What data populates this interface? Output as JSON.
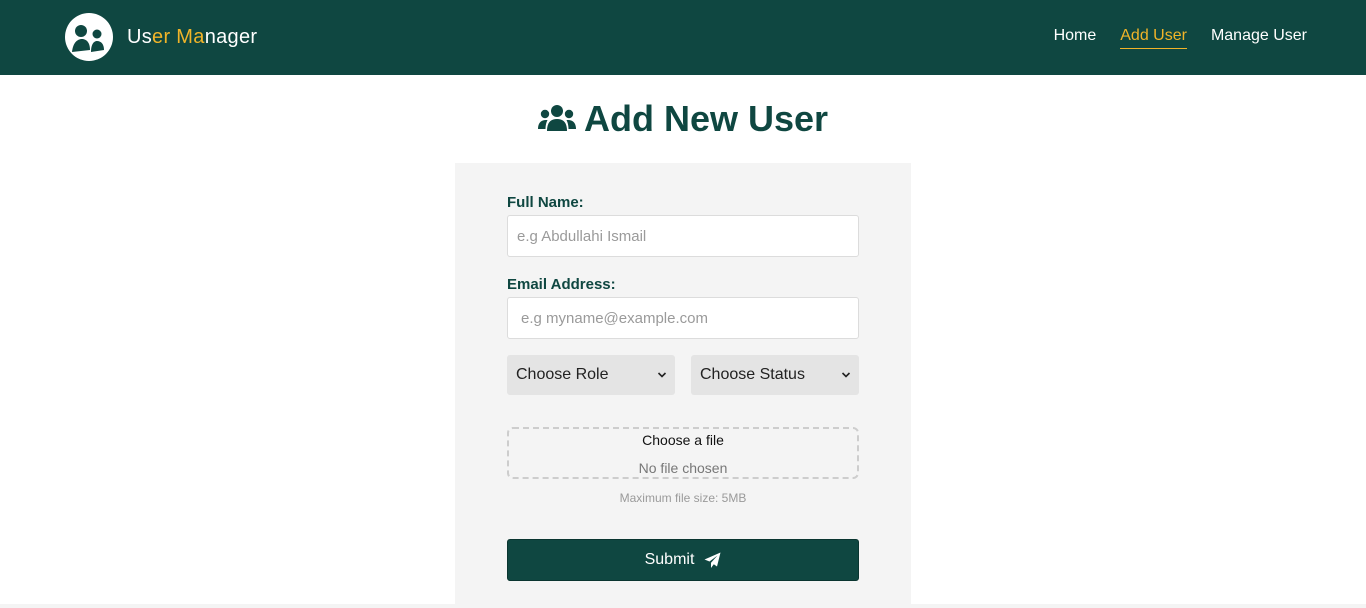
{
  "brand": {
    "name_part1": "Us",
    "name_part2": "er",
    "name_part3": " ",
    "name_part4": "Ma",
    "name_part5": "nager",
    "accent_color": "#f0b429",
    "bar_color": "#0f4741",
    "logo_icon": "user-group-logo-icon"
  },
  "nav": {
    "items": [
      {
        "label": "Home",
        "active": false
      },
      {
        "label": "Add User",
        "active": true
      },
      {
        "label": "Manage User",
        "active": false
      }
    ]
  },
  "page": {
    "title": "Add New User",
    "title_icon": "users-icon"
  },
  "form": {
    "full_name": {
      "label": "Full Name:",
      "value": "",
      "placeholder": "e.g Abdullahi Ismail"
    },
    "email": {
      "label": "Email Address:",
      "value": "",
      "placeholder": "e.g myname@example.com"
    },
    "role_select": {
      "selected": "Choose Role"
    },
    "status_select": {
      "selected": "Choose Status"
    },
    "file": {
      "choose_label": "Choose a file",
      "status": "No file chosen",
      "hint": "Maximum file size: 5MB"
    },
    "submit": {
      "label": "Submit",
      "icon": "paper-plane-icon"
    }
  }
}
